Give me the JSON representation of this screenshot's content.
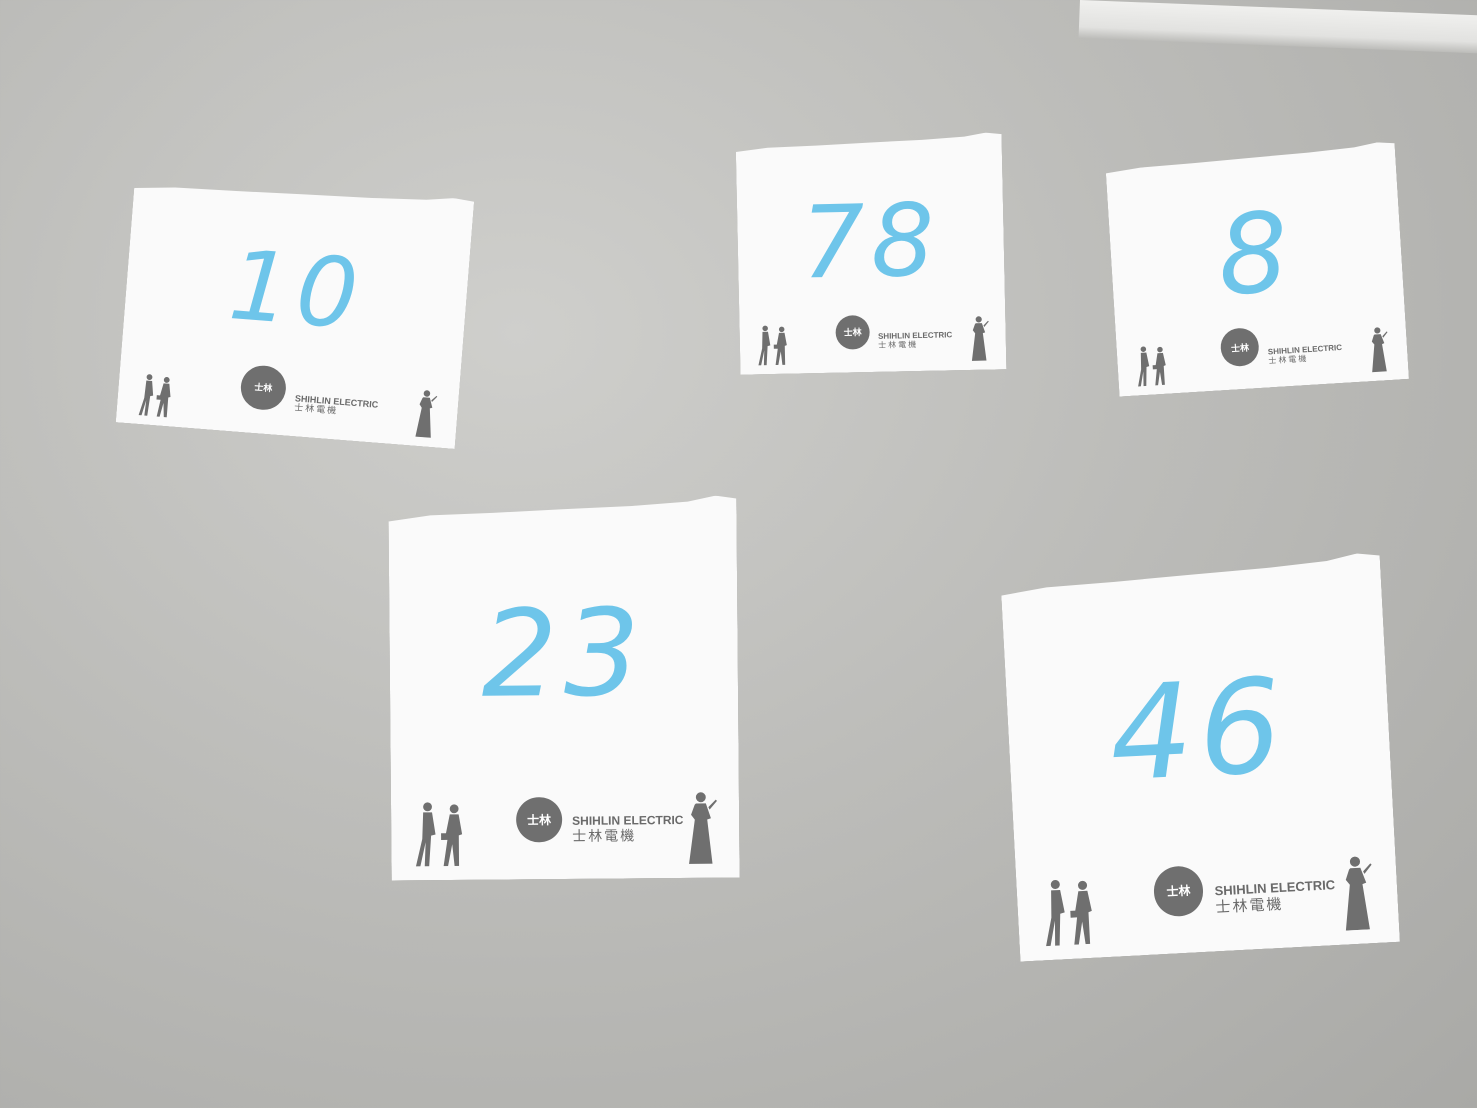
{
  "notes": [
    {
      "number": "10",
      "brand_en": "SHIHLIN ELECTRIC",
      "brand_zh": "士林電機",
      "logo_text": "士林"
    },
    {
      "number": "78",
      "brand_en": "SHIHLIN ELECTRIC",
      "brand_zh": "士林電機",
      "logo_text": "士林"
    },
    {
      "number": "8",
      "brand_en": "SHIHLIN ELECTRIC",
      "brand_zh": "士林電機",
      "logo_text": "士林"
    },
    {
      "number": "23",
      "brand_en": "SHIHLIN ELECTRIC",
      "brand_zh": "士林電機",
      "logo_text": "士林"
    },
    {
      "number": "46",
      "brand_en": "SHIHLIN ELECTRIC",
      "brand_zh": "士林電機",
      "logo_text": "士林"
    }
  ],
  "colors": {
    "ink": "#6ec5ea",
    "paper": "#fafafa",
    "print": "#6a6a6a",
    "table": "#bdbdba"
  }
}
